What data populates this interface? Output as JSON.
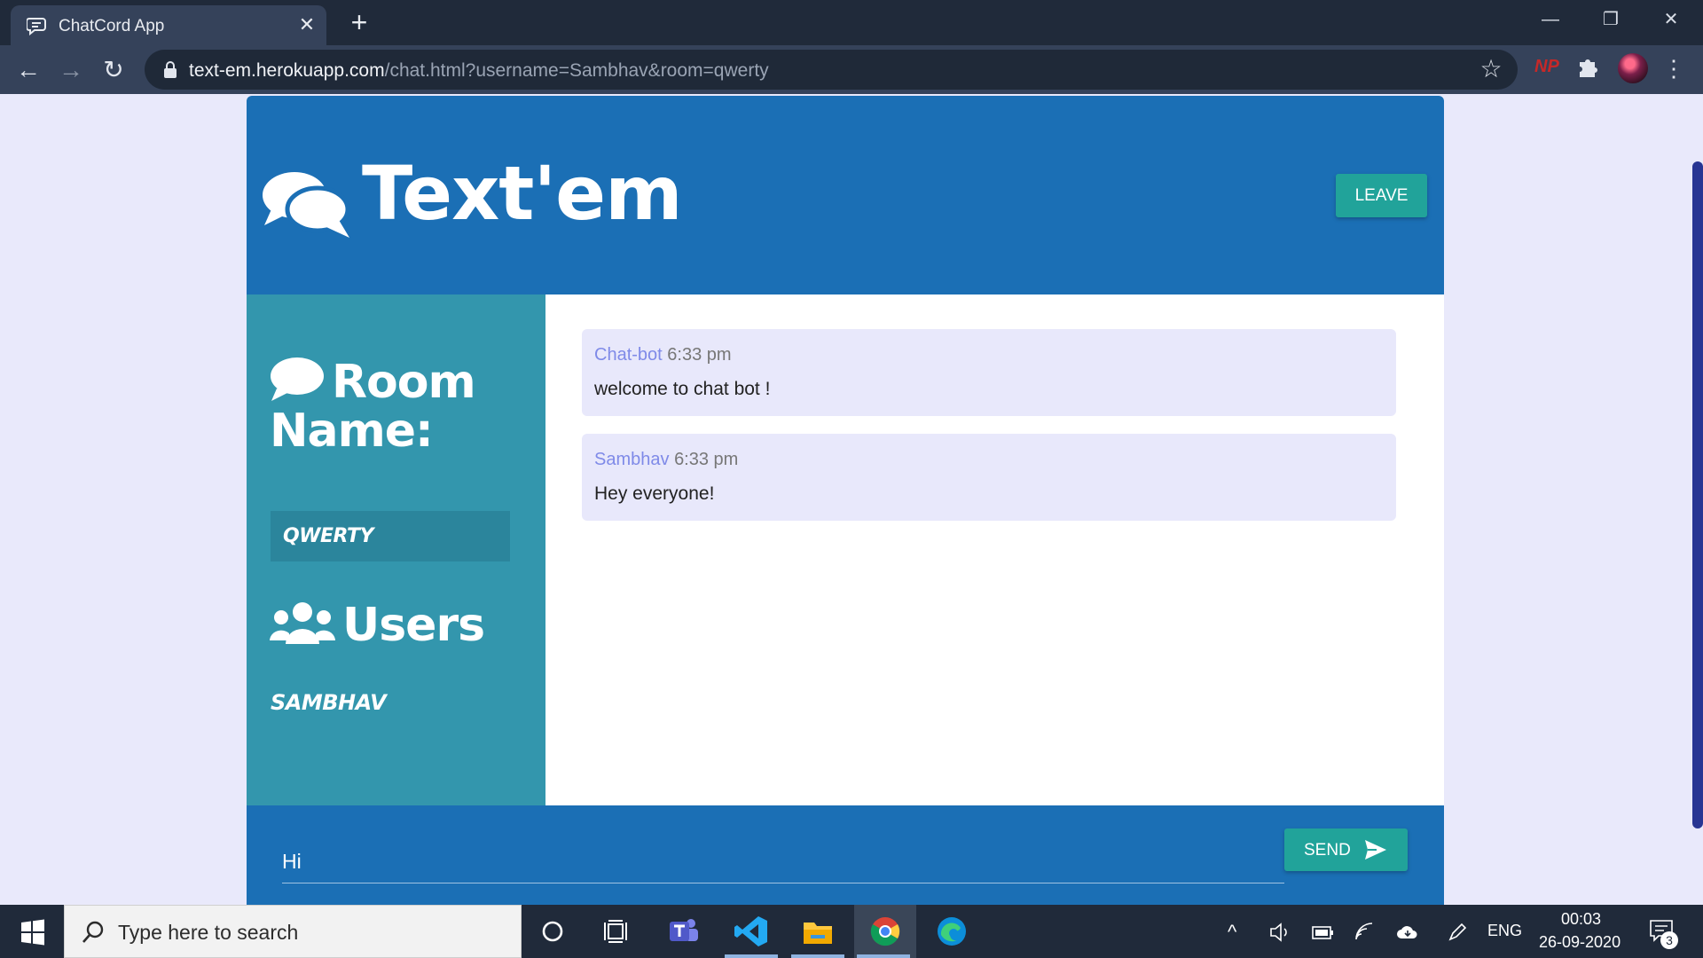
{
  "browser": {
    "tab_title": "ChatCord App",
    "url_host": "text-em.herokuapp.com",
    "url_path": "/chat.html?username=Sambhav&room=qwerty",
    "extension_badge": "NP"
  },
  "header": {
    "logo_text": "Text'em",
    "leave_label": "LEAVE"
  },
  "sidebar": {
    "room_heading": "Room Name:",
    "room_name": "QWERTY",
    "users_heading": "Users",
    "users": [
      "SAMBHAV"
    ]
  },
  "messages": [
    {
      "user": "Chat-bot",
      "time": "6:33 pm",
      "text": "welcome to chat bot !"
    },
    {
      "user": "Sambhav",
      "time": "6:33 pm",
      "text": "Hey everyone!"
    }
  ],
  "form": {
    "input_value": "Hi",
    "send_label": "SEND"
  },
  "taskbar": {
    "search_placeholder": "Type here to search",
    "language": "ENG",
    "time": "00:03",
    "date": "26-09-2020",
    "notification_count": "3"
  },
  "colors": {
    "header_blue": "#1b6fb5",
    "sidebar_teal": "#3396ad",
    "button_green": "#21a39a",
    "message_bg": "#e8e8fb",
    "username_color": "#7f8ae8"
  }
}
